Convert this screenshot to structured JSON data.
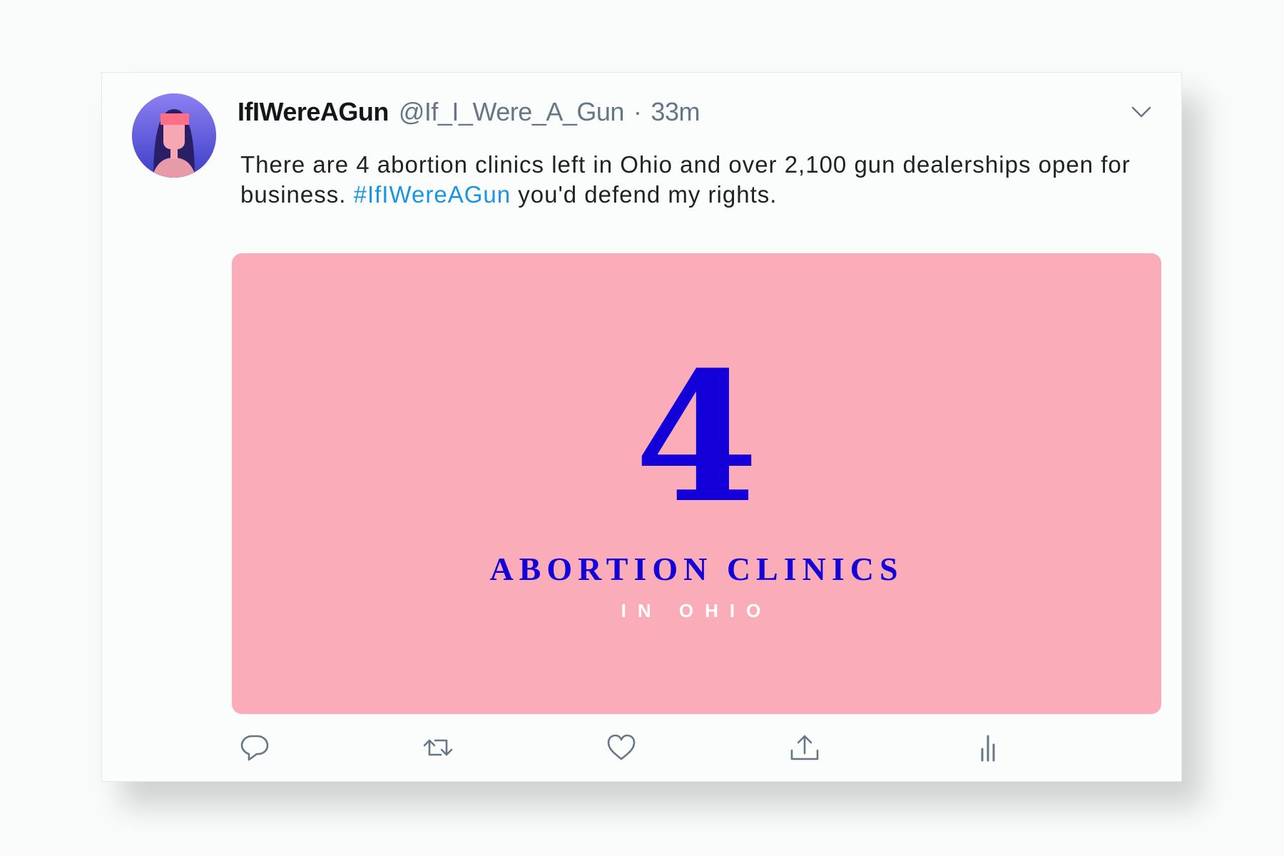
{
  "tweet": {
    "display_name": "IfIWereAGun",
    "handle": "@If_I_Were_A_Gun",
    "separator": "·",
    "time": "33m",
    "text_before": "There are 4 abortion clinics left in Ohio and over 2,100 gun dealerships open for business. ",
    "hashtag": "#IfIWereAGun",
    "text_after": " you'd defend my rights."
  },
  "media": {
    "number": "4",
    "title": "ABORTION CLINICS",
    "subtitle": "IN OHIO",
    "background_color": "#faadb8",
    "accent_color": "#1300d8"
  },
  "actions": [
    {
      "name": "reply",
      "icon": "reply-icon"
    },
    {
      "name": "retweet",
      "icon": "retweet-icon"
    },
    {
      "name": "like",
      "icon": "heart-icon"
    },
    {
      "name": "share",
      "icon": "share-icon"
    },
    {
      "name": "analytics",
      "icon": "analytics-icon"
    }
  ],
  "colors": {
    "link": "#1b95e0",
    "muted": "#657786",
    "text": "#14171a"
  }
}
